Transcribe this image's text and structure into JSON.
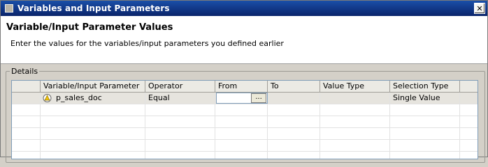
{
  "window": {
    "title": "Variables and Input Parameters",
    "close_label": "✕"
  },
  "header": {
    "title": "Variable/Input Parameter Values",
    "description": "Enter the values for the variables/input parameters you defined earlier"
  },
  "details": {
    "legend": "Details",
    "columns": [
      "Variable/Input Parameter",
      "Operator",
      "From",
      "To",
      "Value Type",
      "Selection Type"
    ],
    "rows": [
      {
        "variable": "p_sales_doc",
        "operator": "Equal",
        "from": "",
        "from_button": "...",
        "to": "",
        "value_type": "",
        "selection_type": "Single Value",
        "icon": "warning-triangle-icon"
      }
    ]
  }
}
